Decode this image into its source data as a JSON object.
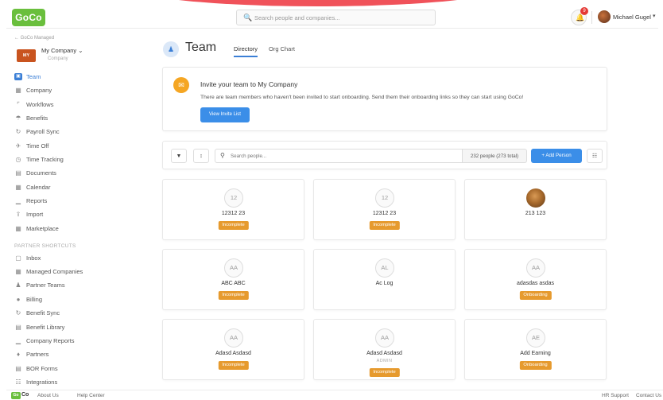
{
  "header": {
    "logo_text": "GoCo",
    "search_placeholder": "Search people and companies...",
    "notifications_count": "9",
    "user_name": "Michael Gugel"
  },
  "sidebar": {
    "back_link": "← GoCo Managed",
    "company_initials": "MY",
    "company_name": "My Company",
    "company_sub": "Company",
    "main_items": [
      {
        "label": "Team",
        "icon": "team-icon"
      },
      {
        "label": "Company",
        "icon": "building-icon"
      },
      {
        "label": "Workflows",
        "icon": "workflows-icon"
      },
      {
        "label": "Benefits",
        "icon": "umbrella-icon"
      },
      {
        "label": "Payroll Sync",
        "icon": "sync-icon"
      },
      {
        "label": "Time Off",
        "icon": "plane-icon"
      },
      {
        "label": "Time Tracking",
        "icon": "clock-icon"
      },
      {
        "label": "Documents",
        "icon": "document-icon"
      },
      {
        "label": "Calendar",
        "icon": "calendar-icon"
      },
      {
        "label": "Reports",
        "icon": "chart-icon"
      },
      {
        "label": "Import",
        "icon": "upload-icon"
      },
      {
        "label": "Marketplace",
        "icon": "store-icon"
      }
    ],
    "section_label": "PARTNER SHORTCUTS",
    "partner_items": [
      {
        "label": "Inbox",
        "icon": "inbox-icon"
      },
      {
        "label": "Managed Companies",
        "icon": "building-icon"
      },
      {
        "label": "Partner Teams",
        "icon": "team-icon"
      },
      {
        "label": "Billing",
        "icon": "billing-icon"
      },
      {
        "label": "Benefit Sync",
        "icon": "sync-icon"
      },
      {
        "label": "Benefit Library",
        "icon": "library-icon"
      },
      {
        "label": "Company Reports",
        "icon": "chart-icon"
      },
      {
        "label": "Partners",
        "icon": "handshake-icon"
      },
      {
        "label": "BOR Forms",
        "icon": "document-icon"
      },
      {
        "label": "Integrations",
        "icon": "integrations-icon"
      }
    ]
  },
  "main": {
    "title": "Team",
    "tabs": [
      {
        "label": "Directory"
      },
      {
        "label": "Org Chart"
      }
    ],
    "invite": {
      "title": "Invite your team to My Company",
      "text": "There are team members who haven't been invited to start onboarding. Send them their onboarding links so they can start using GoCo!",
      "button": "View Invite List"
    },
    "toolbar": {
      "search_placeholder": "Search people...",
      "count": "232 people (273 total)",
      "add_button": "+ Add Person"
    },
    "people": [
      {
        "initials": "12",
        "name": "12312 23",
        "status": "Incomplete"
      },
      {
        "initials": "12",
        "name": "12312 23",
        "status": "Incomplete"
      },
      {
        "initials": "",
        "name": "213 123",
        "status": ""
      },
      {
        "initials": "AA",
        "name": "ABC ABC",
        "status": "Incomplete"
      },
      {
        "initials": "AL",
        "name": "Ac Log",
        "status": ""
      },
      {
        "initials": "AA",
        "name": "adasdas asdas",
        "status": "Onboarding"
      },
      {
        "initials": "AA",
        "name": "Adasd Asdasd",
        "status": "Incomplete"
      },
      {
        "initials": "AA",
        "name": "Adasd Asdasd",
        "sub": "ADMIN",
        "status": "Incomplete"
      },
      {
        "initials": "AE",
        "name": "Add Earning",
        "status": "Onboarding"
      }
    ]
  },
  "footer": {
    "logo_text": "Go",
    "co_text": "Co",
    "links": [
      "About Us",
      "Help Center"
    ],
    "right_links": [
      "HR Support",
      "Contact Us"
    ]
  },
  "colors": {
    "accent": "#3b8ee8",
    "brand_green": "#6abf3d",
    "badge_orange": "#e69a2e",
    "top_arc": "#f0525a"
  }
}
